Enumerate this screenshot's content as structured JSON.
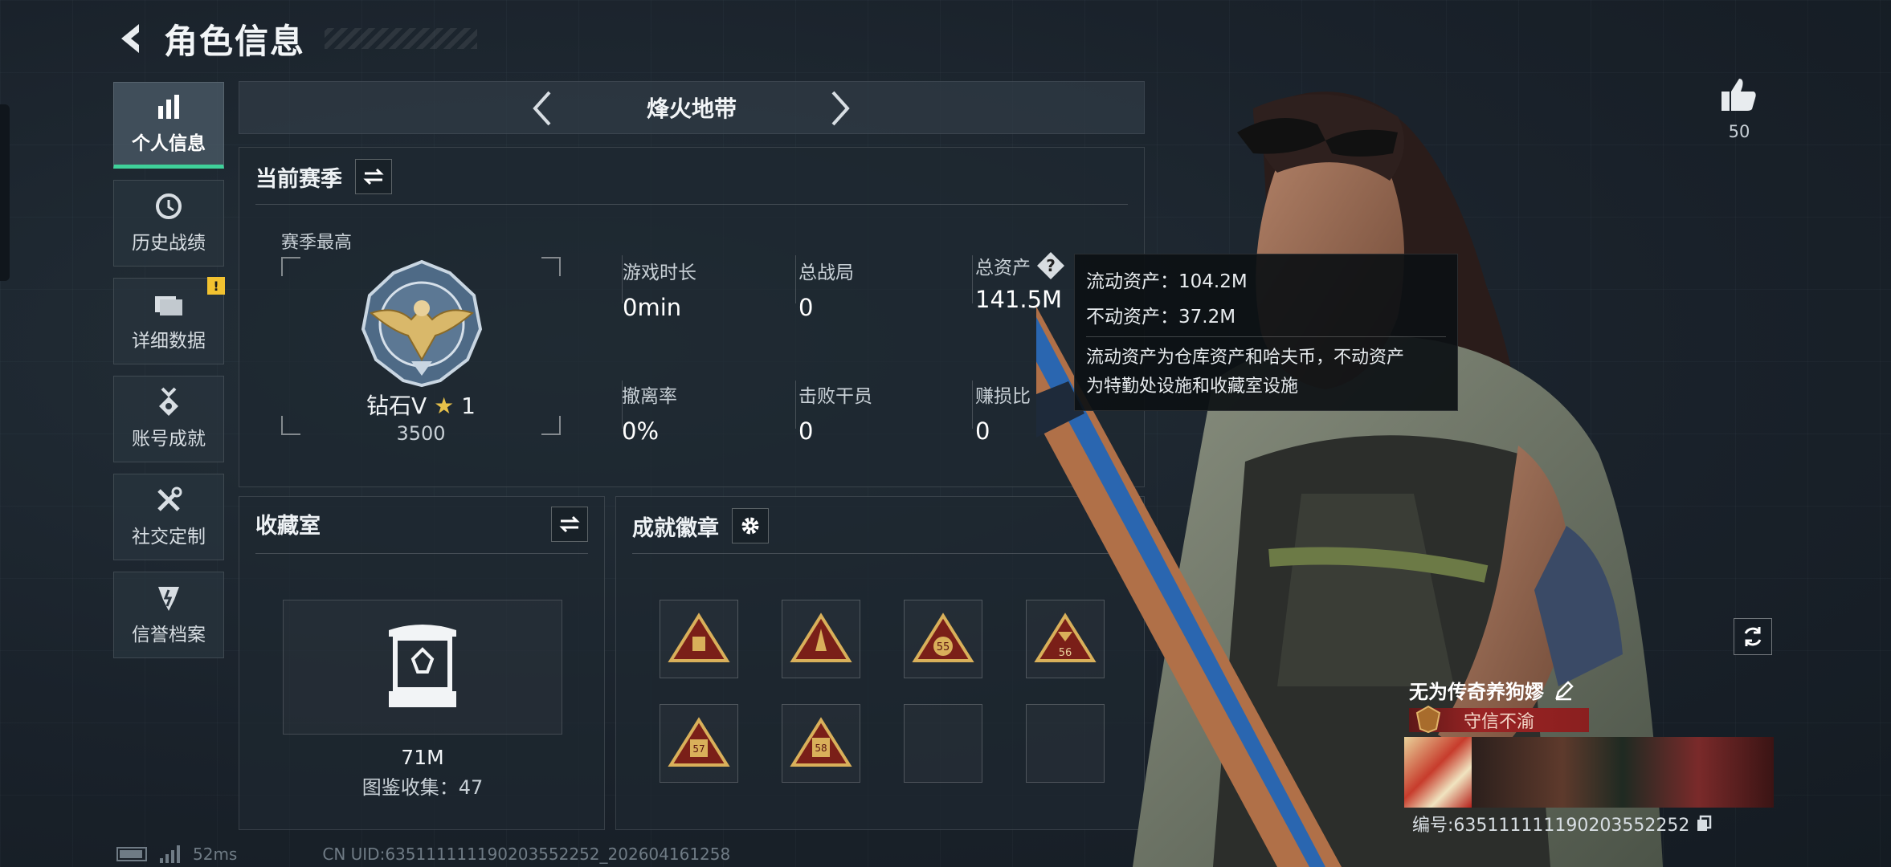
{
  "header": {
    "title": "角色信息"
  },
  "nav": {
    "items": [
      {
        "label": "个人信息",
        "active": true,
        "icon": "bar-chart-icon"
      },
      {
        "label": "历史战绩",
        "icon": "history-clock-icon"
      },
      {
        "label": "详细数据",
        "icon": "folders-icon",
        "badge": "!"
      },
      {
        "label": "账号成就",
        "icon": "achievement-medal-icon"
      },
      {
        "label": "社交定制",
        "icon": "tools-icon"
      },
      {
        "label": "信誉档案",
        "icon": "credit-shield-icon"
      }
    ]
  },
  "mode": {
    "title": "烽火地带"
  },
  "season": {
    "title": "当前赛季",
    "best_label": "赛季最高",
    "rank_name": "钻石V",
    "rank_stars": "1",
    "rank_score": "3500",
    "stats": [
      {
        "label": "游戏时长",
        "value": "0min"
      },
      {
        "label": "总战局",
        "value": "0"
      },
      {
        "label": "总资产",
        "value": "141.5M"
      },
      {
        "label": "撤离率",
        "value": "0%"
      },
      {
        "label": "击败干员",
        "value": "0"
      },
      {
        "label": "赚损比",
        "value": "0"
      }
    ]
  },
  "tooltip": {
    "liquid": "流动资产：104.2M",
    "fixed": "不动资产：37.2M",
    "note_line1": "流动资产为仓库资产和哈夫币，不动资产",
    "note_line2": "为特勤处设施和收藏室设施"
  },
  "collection": {
    "title": "收藏室",
    "value": "71M",
    "count": "图鉴收集：47"
  },
  "badges": {
    "title": "成就徽章",
    "items": [
      "",
      "",
      "55",
      "56",
      "57",
      "58",
      null,
      null
    ]
  },
  "profile": {
    "likes": "50",
    "player_name": "无为传奇养狗嫪",
    "honor_title": "守信不渝",
    "id_line": "编号:635111111190203552252"
  },
  "status": {
    "ping": "52ms",
    "uid": "CN UID:635111111190203552252_202604161258"
  },
  "colors": {
    "accent_green": "#3fd19a",
    "badge_gold": "#c9a24a",
    "title_red": "#9a2424"
  }
}
